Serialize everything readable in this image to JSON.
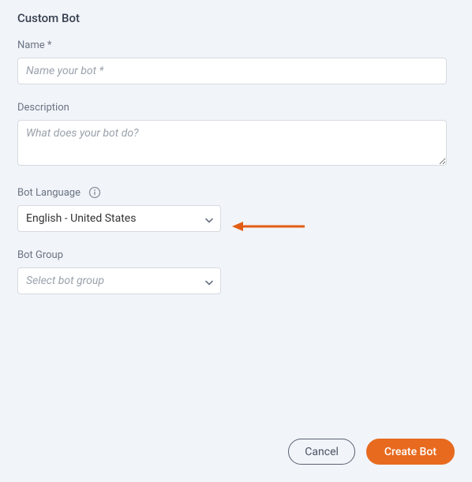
{
  "title": "Custom Bot",
  "fields": {
    "name": {
      "label": "Name *",
      "placeholder": "Name your bot *",
      "value": ""
    },
    "description": {
      "label": "Description",
      "placeholder": "What does your bot do?",
      "value": ""
    },
    "language": {
      "label": "Bot Language",
      "selected": "English - United States"
    },
    "group": {
      "label": "Bot Group",
      "placeholder": "Select bot group",
      "selected": ""
    }
  },
  "buttons": {
    "cancel": "Cancel",
    "create": "Create Bot"
  },
  "colors": {
    "accent": "#e86a1f",
    "annotation": "#e25d13"
  }
}
